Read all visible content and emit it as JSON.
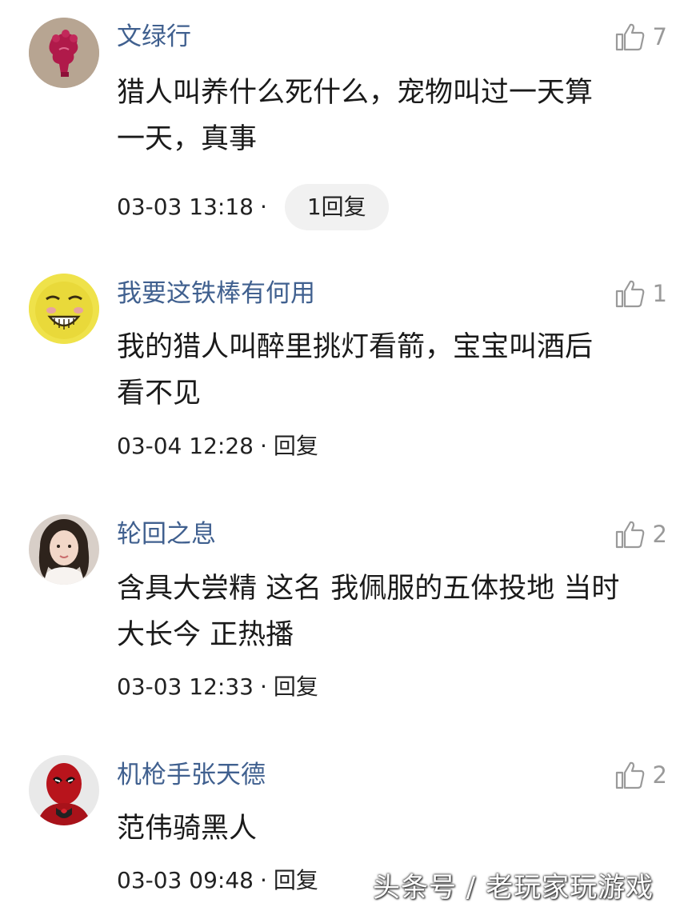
{
  "comments": [
    {
      "username": "文绿行",
      "likes": "7",
      "lines": [
        "猎人叫养什么死什么，宠物叫过一天算",
        "一天，真事"
      ],
      "time": "03-03 13:18",
      "sep": "·",
      "reply_label": "1回复"
    },
    {
      "username": "我要这铁棒有何用",
      "likes": "1",
      "lines": [
        "我的猎人叫醉里挑灯看箭，宝宝叫酒后",
        "看不见"
      ],
      "time": "03-04 12:28",
      "sep": "·",
      "reply_label": "回复"
    },
    {
      "username": "轮回之息",
      "likes": "2",
      "lines": [
        "含具大尝精 这名 我佩服的五体投地 当时",
        "大长今 正热播"
      ],
      "time": "03-03 12:33",
      "sep": "·",
      "reply_label": "回复"
    },
    {
      "username": "机枪手张天德",
      "likes": "2",
      "lines": [
        "范伟骑黑人"
      ],
      "time": "03-03 09:48",
      "sep": "·",
      "reply_label": "回复"
    }
  ],
  "watermark": "头条号 / 老玩家玩游戏",
  "icons": {
    "like": "thumbs-up-icon"
  },
  "colors": {
    "username": "#40608f",
    "text": "#1a1a1a",
    "muted": "#9a9a9a",
    "pill_bg": "#f1f1f1"
  }
}
